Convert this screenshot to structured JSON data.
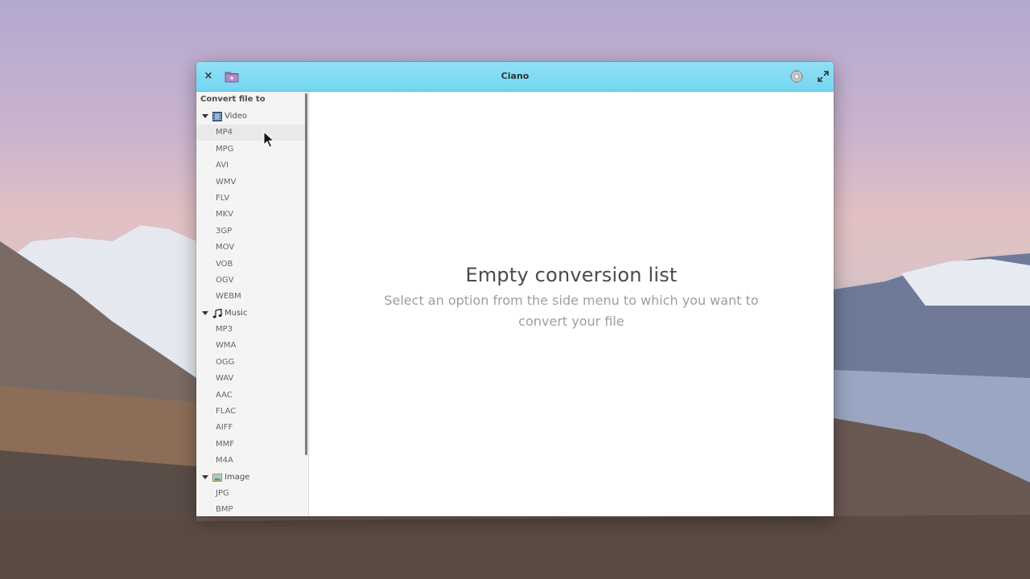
{
  "window": {
    "title": "Ciano",
    "close_glyph": "×"
  },
  "sidebar": {
    "heading": "Convert file to",
    "categories": [
      {
        "label": "Video",
        "icon": "film-icon",
        "items": [
          "MP4",
          "MPG",
          "AVI",
          "WMV",
          "FLV",
          "MKV",
          "3GP",
          "MOV",
          "VOB",
          "OGV",
          "WEBM"
        ]
      },
      {
        "label": "Music",
        "icon": "music-note-icon",
        "items": [
          "MP3",
          "WMA",
          "OGG",
          "WAV",
          "AAC",
          "FLAC",
          "AIFF",
          "MMF",
          "M4A"
        ]
      },
      {
        "label": "Image",
        "icon": "image-icon",
        "items": [
          "JPG",
          "BMP"
        ]
      }
    ]
  },
  "main": {
    "empty_title": "Empty conversion list",
    "empty_subtitle": "Select an option from the side menu to which you want to convert your file"
  },
  "colors": {
    "titlebar": "#7ad8f3",
    "sidebar_bg": "#f4f4f4"
  }
}
